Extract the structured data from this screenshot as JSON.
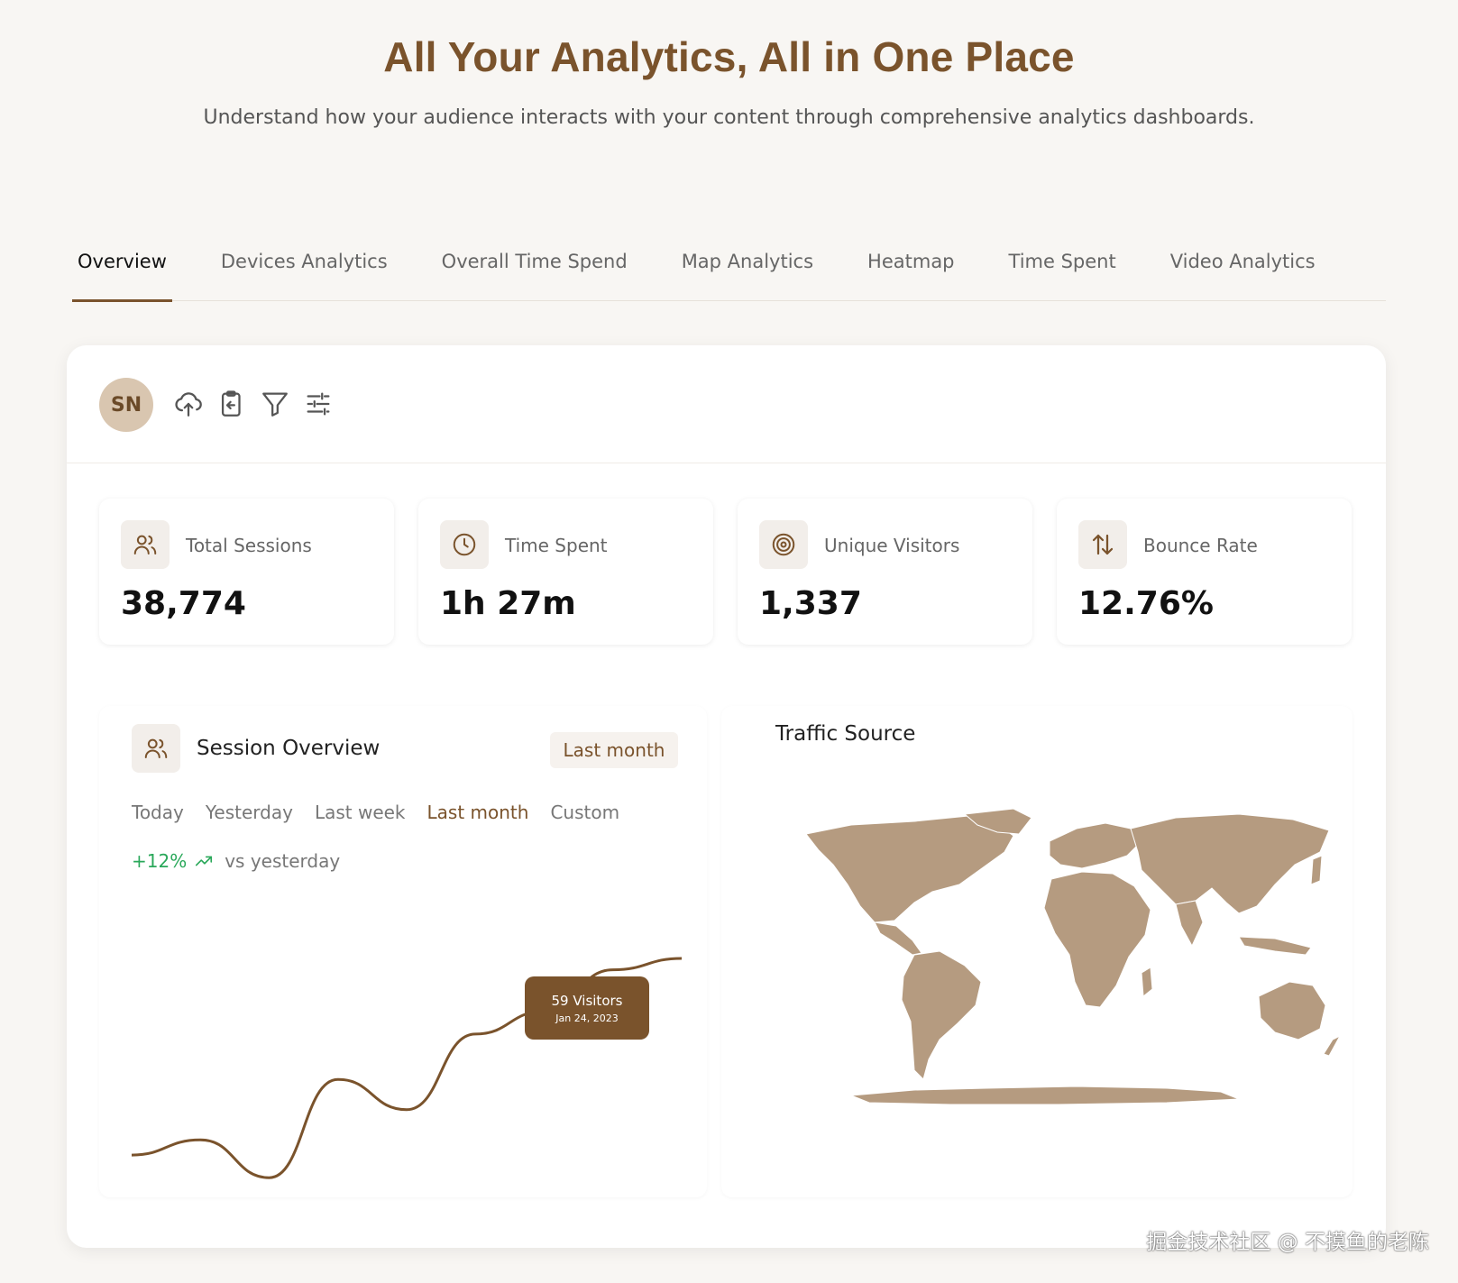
{
  "hero": {
    "title": "All Your Analytics, All in One Place",
    "subtitle": "Understand how your audience interacts with your content through comprehensive analytics dashboards."
  },
  "tabs": [
    {
      "label": "Overview",
      "active": true
    },
    {
      "label": "Devices Analytics"
    },
    {
      "label": "Overall Time Spend"
    },
    {
      "label": "Map Analytics"
    },
    {
      "label": "Heatmap"
    },
    {
      "label": "Time Spent"
    },
    {
      "label": "Video Analytics"
    }
  ],
  "toolbar": {
    "avatar_initials": "SN",
    "icons": [
      "upload-cloud-icon",
      "clipboard-icon",
      "filter-icon",
      "sliders-icon"
    ]
  },
  "stats": [
    {
      "label": "Total Sessions",
      "value": "38,774",
      "icon": "users-icon"
    },
    {
      "label": "Time Spent",
      "value": "1h 27m",
      "icon": "clock-icon"
    },
    {
      "label": "Unique Visitors",
      "value": "1,337",
      "icon": "target-icon"
    },
    {
      "label": "Bounce Rate",
      "value": "12.76%",
      "icon": "arrows-up-down-icon"
    }
  ],
  "session_overview": {
    "title": "Session Overview",
    "range_button": "Last month",
    "ranges": [
      "Today",
      "Yesterday",
      "Last week",
      "Last month",
      "Custom"
    ],
    "active_range": "Last month",
    "trend_pct": "+12%",
    "trend_text": "vs yesterday",
    "tooltip": {
      "value": "59 Visitors",
      "date": "Jan 24, 2023"
    }
  },
  "traffic_source": {
    "title": "Traffic Source"
  },
  "watermark": "掘金技术社区 @ 不摸鱼的老陈",
  "colors": {
    "brand": "#7a532c",
    "map": "#b59b80",
    "positive": "#2aa85a"
  },
  "chart_data": {
    "type": "line",
    "series": [
      {
        "values": [
          10,
          14,
          4,
          30,
          22,
          42,
          48,
          59,
          62
        ]
      }
    ]
  }
}
